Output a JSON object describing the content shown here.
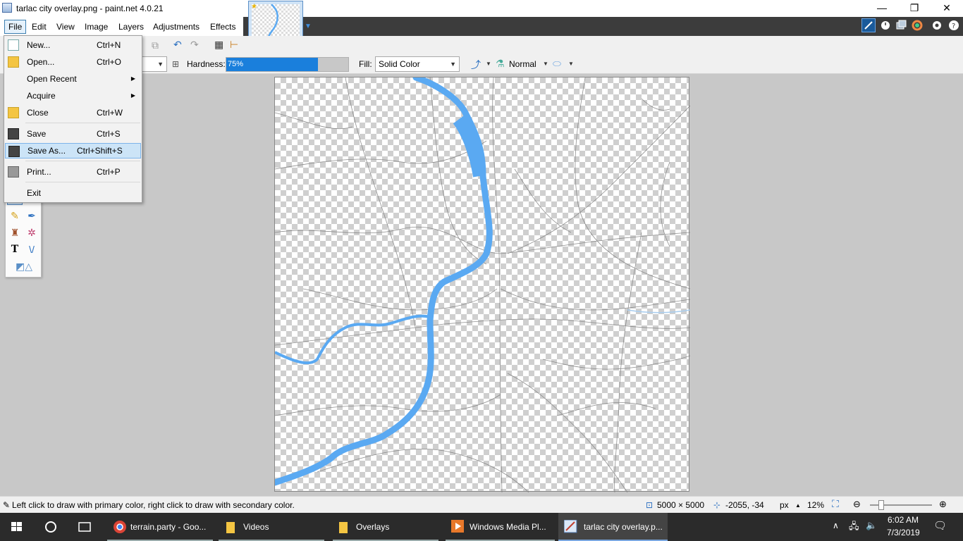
{
  "window": {
    "title": "tarlac city overlay.png - paint.net 4.0.21",
    "minimize": "—",
    "restore": "❐",
    "close": "✕"
  },
  "menubar": [
    "File",
    "Edit",
    "View",
    "Image",
    "Layers",
    "Adjustments",
    "Effects"
  ],
  "file_menu": {
    "items": [
      {
        "label": "New...",
        "shortcut": "Ctrl+N"
      },
      {
        "label": "Open...",
        "shortcut": "Ctrl+O"
      },
      {
        "label": "Open Recent",
        "shortcut": ""
      },
      {
        "label": "Acquire",
        "shortcut": ""
      },
      {
        "label": "Close",
        "shortcut": "Ctrl+W"
      },
      {
        "label": "Save",
        "shortcut": "Ctrl+S"
      },
      {
        "label": "Save As...",
        "shortcut": "Ctrl+Shift+S"
      },
      {
        "label": "Print...",
        "shortcut": "Ctrl+P"
      },
      {
        "label": "Exit",
        "shortcut": ""
      }
    ],
    "submenu_arrow": "▶"
  },
  "toolbar": {
    "hardness_label": "Hardness:",
    "hardness_value": "75%",
    "hardness_fraction": 0.75,
    "fill_label": "Fill:",
    "fill_value": "Solid Color",
    "blend_mode": "Normal"
  },
  "status": {
    "hint": "Left click to draw with primary color, right click to draw with secondary color.",
    "image_size": "5000 × 5000",
    "cursor_pos": "-2055, -34",
    "units": "px",
    "zoom": "12%"
  },
  "taskbar": {
    "items": [
      {
        "label": "terrain.party - Goo..."
      },
      {
        "label": "Videos"
      },
      {
        "label": "Overlays"
      },
      {
        "label": "Windows Media Pl..."
      },
      {
        "label": "tarlac city overlay.p..."
      }
    ],
    "time": "6:02 AM",
    "date": "7/3/2019"
  },
  "colors": {
    "accent": "#1a7fdc",
    "river": "#5aa9f2",
    "menu_hover": "#cce4f7",
    "taskbar": "#2b2b2b"
  }
}
